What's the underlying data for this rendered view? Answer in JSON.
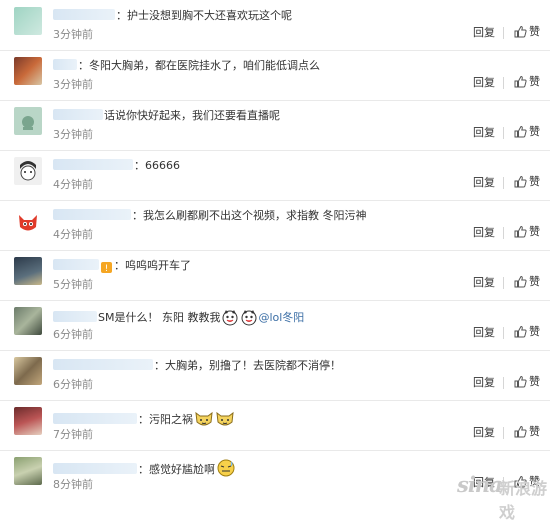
{
  "reply_label": "回复",
  "like_label": "赞",
  "comments": [
    {
      "text": "：护士没想到胸不大还喜欢玩这个呢",
      "time": "3分钟前"
    },
    {
      "text": "：冬阳大胸弟，都在医院挂水了，咱们能低调点么",
      "time": "3分钟前"
    },
    {
      "text": "话说你快好起来，我们还要看直播呢",
      "time": "3分钟前"
    },
    {
      "text": "：66666",
      "time": "4分钟前"
    },
    {
      "text": "：我怎么刷都刷不出这个视频，求指教 冬阳污神",
      "time": "4分钟前"
    },
    {
      "text": "：呜呜呜开车了",
      "time": "5分钟前"
    },
    {
      "text": "SM是什么！  东阳 教教我",
      "mention": "@lol冬阳",
      "time": "6分钟前"
    },
    {
      "text": "：大胸弟，别撸了！去医院都不消停！",
      "time": "6分钟前"
    },
    {
      "text": "：污阳之祸",
      "time": "7分钟前"
    },
    {
      "text": "：感觉好尴尬啊",
      "time": "8分钟前"
    }
  ],
  "watermark": {
    "brand": "sina",
    "game": "新浪游戏"
  }
}
